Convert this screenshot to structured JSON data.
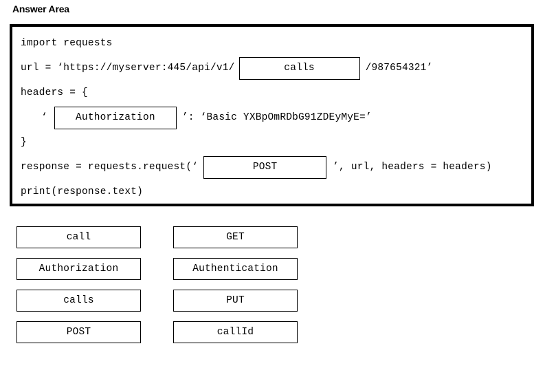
{
  "heading": {
    "title": "Answer Area"
  },
  "code_panel": {
    "lines": {
      "import": "import requests",
      "url_prefix": "url = ‘https://myserver:445/api/v1/",
      "url_suffix": "/987654321’",
      "headers_open": "headers = {",
      "header_quote_open": "‘",
      "header_value": "’: ‘Basic YXBpOmRDbG91ZDEyMyE=’",
      "headers_close": "}",
      "response_prefix": "response = requests.request(‘",
      "response_suffix": "’, url, headers = headers)",
      "print": "print(response.text)"
    },
    "drop_boxes": {
      "url_segment": "calls",
      "header_name": "Authorization",
      "http_method": "POST"
    }
  },
  "options": {
    "left_column": [
      {
        "label": "call"
      },
      {
        "label": "Authorization"
      },
      {
        "label": "calls"
      },
      {
        "label": "POST"
      }
    ],
    "right_column": [
      {
        "label": "GET"
      },
      {
        "label": "Authentication"
      },
      {
        "label": "PUT"
      },
      {
        "label": "callId"
      }
    ]
  },
  "colors": {
    "border": "#000000",
    "text": "#000000",
    "background": "#ffffff"
  }
}
